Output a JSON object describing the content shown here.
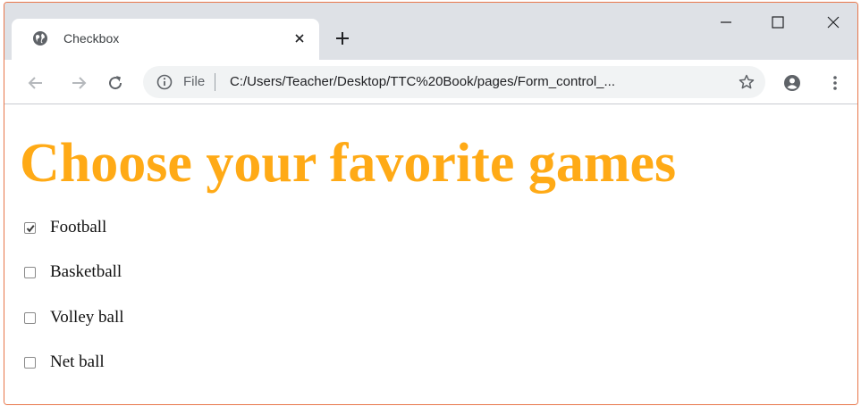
{
  "tab": {
    "title": "Checkbox",
    "favicon": "globe-icon"
  },
  "toolbar": {
    "scheme_label": "File",
    "url": "C:/Users/Teacher/Desktop/TTC%20Book/pages/Form_control_..."
  },
  "page": {
    "heading": "Choose your favorite games",
    "heading_color": "#ffaa16",
    "options": [
      {
        "label": "Football",
        "checked": true
      },
      {
        "label": "Basketball",
        "checked": false
      },
      {
        "label": "Volley ball",
        "checked": false
      },
      {
        "label": "Net ball",
        "checked": false
      }
    ]
  },
  "colors": {
    "window_border": "#e8764a",
    "tabstrip": "#dee1e6",
    "omnibox": "#f1f3f4"
  }
}
